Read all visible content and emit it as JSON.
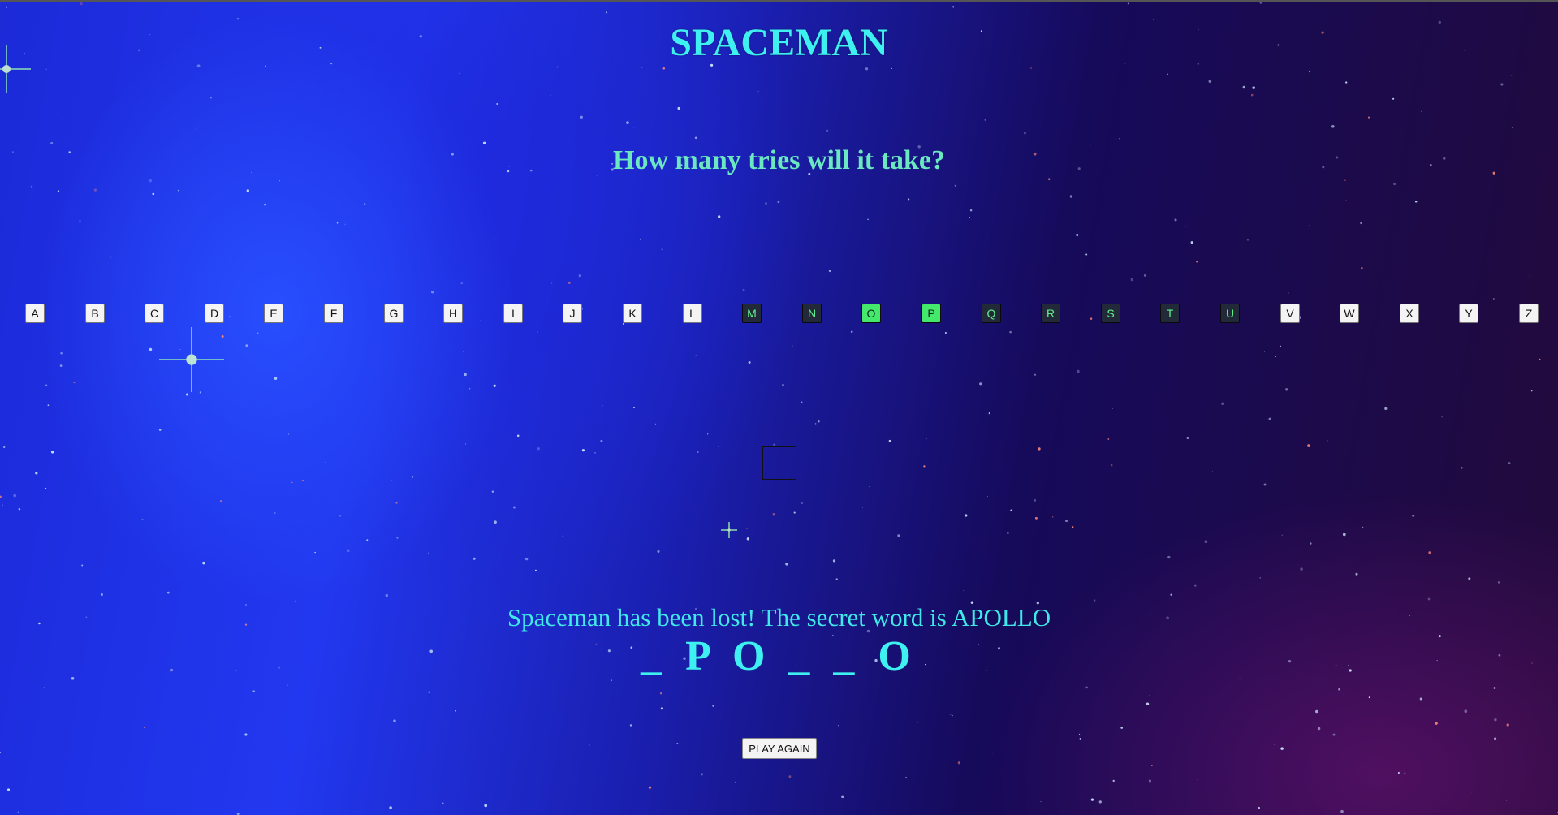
{
  "game": {
    "title": "SPACEMAN",
    "subtitle": "How many tries will it take?",
    "message": "Spaceman has been lost! The secret word is APOLLO",
    "word_display": "_ P O _ _ O",
    "play_again_label": "PLAY AGAIN"
  },
  "letters": [
    {
      "label": "A",
      "state": "unused"
    },
    {
      "label": "B",
      "state": "unused"
    },
    {
      "label": "C",
      "state": "unused"
    },
    {
      "label": "D",
      "state": "unused"
    },
    {
      "label": "E",
      "state": "unused"
    },
    {
      "label": "F",
      "state": "unused"
    },
    {
      "label": "G",
      "state": "unused"
    },
    {
      "label": "H",
      "state": "unused"
    },
    {
      "label": "I",
      "state": "unused"
    },
    {
      "label": "J",
      "state": "unused"
    },
    {
      "label": "K",
      "state": "unused"
    },
    {
      "label": "L",
      "state": "unused"
    },
    {
      "label": "M",
      "state": "wrong"
    },
    {
      "label": "N",
      "state": "wrong"
    },
    {
      "label": "O",
      "state": "right"
    },
    {
      "label": "P",
      "state": "right"
    },
    {
      "label": "Q",
      "state": "wrong"
    },
    {
      "label": "R",
      "state": "wrong"
    },
    {
      "label": "S",
      "state": "wrong"
    },
    {
      "label": "T",
      "state": "wrong"
    },
    {
      "label": "U",
      "state": "wrong"
    },
    {
      "label": "V",
      "state": "unused"
    },
    {
      "label": "W",
      "state": "unused"
    },
    {
      "label": "X",
      "state": "unused"
    },
    {
      "label": "Y",
      "state": "unused"
    },
    {
      "label": "Z",
      "state": "unused"
    }
  ],
  "colors": {
    "title": "#3ff0f0",
    "subtitle": "#6be8c0",
    "wrong_letter_bg": "#222a3a",
    "right_letter_bg": "#44e86a"
  }
}
